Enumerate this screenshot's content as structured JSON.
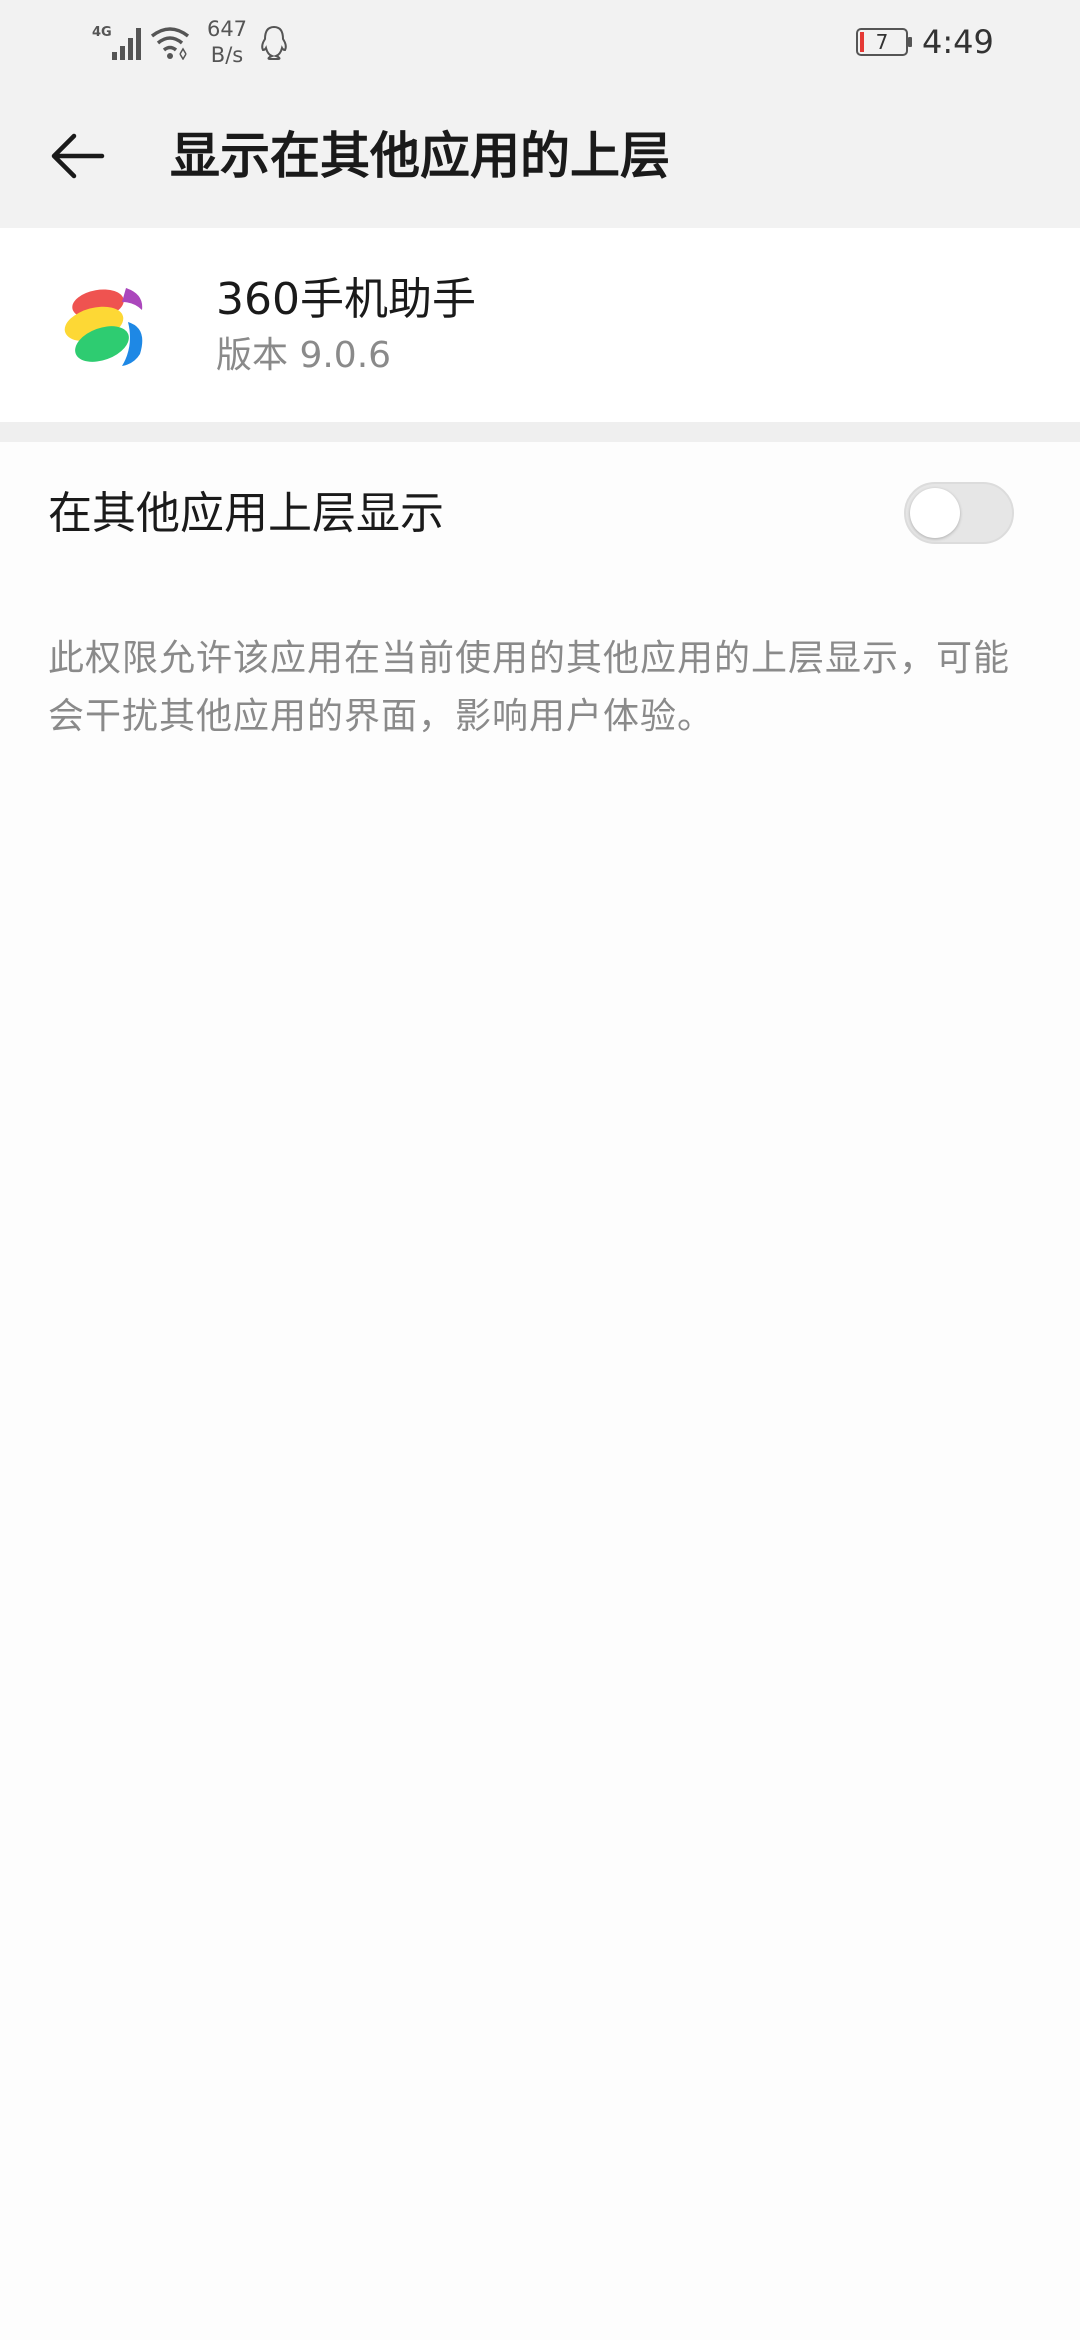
{
  "status_bar": {
    "network_label": "4G",
    "speed_value": "647",
    "speed_unit": "B/s",
    "battery_level": "7",
    "time": "4:49",
    "icons": [
      "signal-4g-icon",
      "wifi-icon",
      "qq-icon",
      "battery-low-icon"
    ]
  },
  "header": {
    "title": "显示在其他应用的上层",
    "back_icon": "back-arrow-icon"
  },
  "app": {
    "name": "360手机助手",
    "version": "版本 9.0.6",
    "icon": "app-360-icon"
  },
  "setting": {
    "label": "在其他应用上层显示",
    "enabled": false,
    "description": "此权限允许该应用在当前使用的其他应用的上层显示，可能会干扰其他应用的界面，影响用户体验。"
  },
  "colors": {
    "header_bg": "#f2f2f2",
    "card_bg": "#ffffff",
    "text_primary": "#1a1a1a",
    "text_secondary": "#8a8a8a",
    "battery_low": "#e53935",
    "toggle_off": "#e6e6e6"
  }
}
